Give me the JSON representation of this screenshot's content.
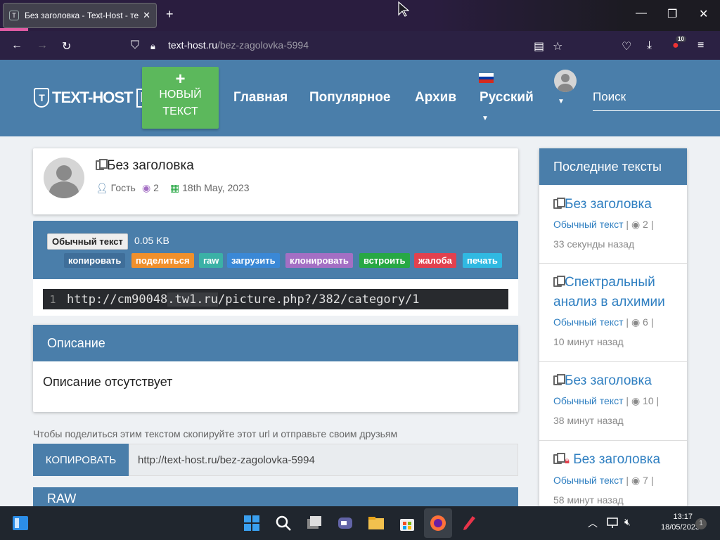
{
  "browser": {
    "tab_title": "Без заголовка - Text-Host - текст",
    "new_tab": "+",
    "url_host": "text-host.ru",
    "url_path": "/bez-zagolovka-5994",
    "downloads_badge": "10"
  },
  "header": {
    "logo_text": "TEXT-HOST",
    "logo_ru": "RU",
    "new_text_plus": "+",
    "new_text_line1": "НОВЫЙ",
    "new_text_line2": "ТЕКСТ",
    "nav": [
      "Главная",
      "Популярное",
      "Архив",
      "Русский"
    ],
    "search_placeholder": "Поиск"
  },
  "post": {
    "title": "Без заголовка",
    "author": "Гость",
    "views": "2",
    "date": "18th May, 2023",
    "type_label": "Обычный текст",
    "size": "0.05 KB",
    "actions": [
      {
        "label": "копировать",
        "color": "#3f6e99"
      },
      {
        "label": "поделиться",
        "color": "#f0902c"
      },
      {
        "label": "raw",
        "color": "#3bb1a6"
      },
      {
        "label": "загрузить",
        "color": "#3a88d6"
      },
      {
        "label": "клонировать",
        "color": "#a46fc4"
      },
      {
        "label": "встроить",
        "color": "#27a844"
      },
      {
        "label": "жалоба",
        "color": "#e2414e"
      },
      {
        "label": "печать",
        "color": "#30b9e2"
      }
    ],
    "line_number": "1",
    "code_a": "http://cm90048",
    "code_b": ".tw1.ru",
    "code_c": "/picture.php?/382/category/1"
  },
  "description": {
    "heading": "Описание",
    "text": "Описание отсутствует"
  },
  "share": {
    "hint": "Чтобы поделиться этим текстом скопируйте этот url и отправьте своим друзьям",
    "button": "КОПИРОВАТЬ",
    "url": "http://text-host.ru/bez-zagolovka-5994"
  },
  "raw_heading": "RAW",
  "sidebar": {
    "heading": "Последние тексты",
    "items": [
      {
        "title": "Без заголовка",
        "type": "Обычный текст",
        "views": "2",
        "time": "33 секунды назад"
      },
      {
        "title": "Спектральный анализ в алхимии",
        "type": "Обычный текст",
        "views": "6",
        "time": "10 минут назад"
      },
      {
        "title": "Без заголовка",
        "type": "Обычный текст",
        "views": "10",
        "time": "38 минут назад"
      },
      {
        "title": "Без заголовка",
        "type": "Обычный текст",
        "views": "7",
        "time": "58 минут назад"
      }
    ]
  },
  "taskbar": {
    "time": "13:17",
    "date": "18/05/2023",
    "notif_count": "1"
  }
}
